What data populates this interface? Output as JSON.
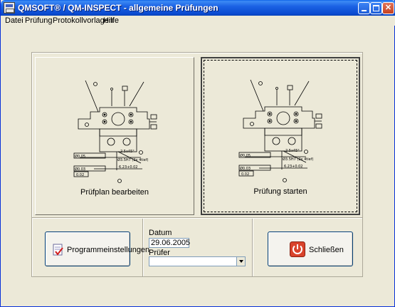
{
  "window": {
    "title": "QMSOFT® / QM-INSPECT - allgemeine Prüfungen"
  },
  "menu": {
    "items": [
      {
        "label": "Datei"
      },
      {
        "label": "Prüfung"
      },
      {
        "label": "Protokollvorlagen"
      },
      {
        "label": "Hilfe"
      }
    ]
  },
  "panels": {
    "edit_plan_label": "Prüfplan bearbeiten",
    "start_test_label": "Prüfung starten"
  },
  "drawing": {
    "dims": {
      "tol1": "Ø0.05",
      "tol2": "Ø0.03",
      "tol3": "0.02",
      "chamfer": "2.5x45°",
      "hole": "Ø3.5H7 (2x 4tief)",
      "depth": "6.23+0.02"
    }
  },
  "bottom": {
    "settings_button": "Programmeinstellungen",
    "date_label": "Datum",
    "date_value": "29.06.2005",
    "inspector_label": "Prüfer",
    "inspector_value": "",
    "close_button": "Schließen"
  },
  "colors": {
    "titlebar": "#0a4ad0",
    "window_bg": "#ece9d8",
    "close_icon": "#d9432b"
  }
}
